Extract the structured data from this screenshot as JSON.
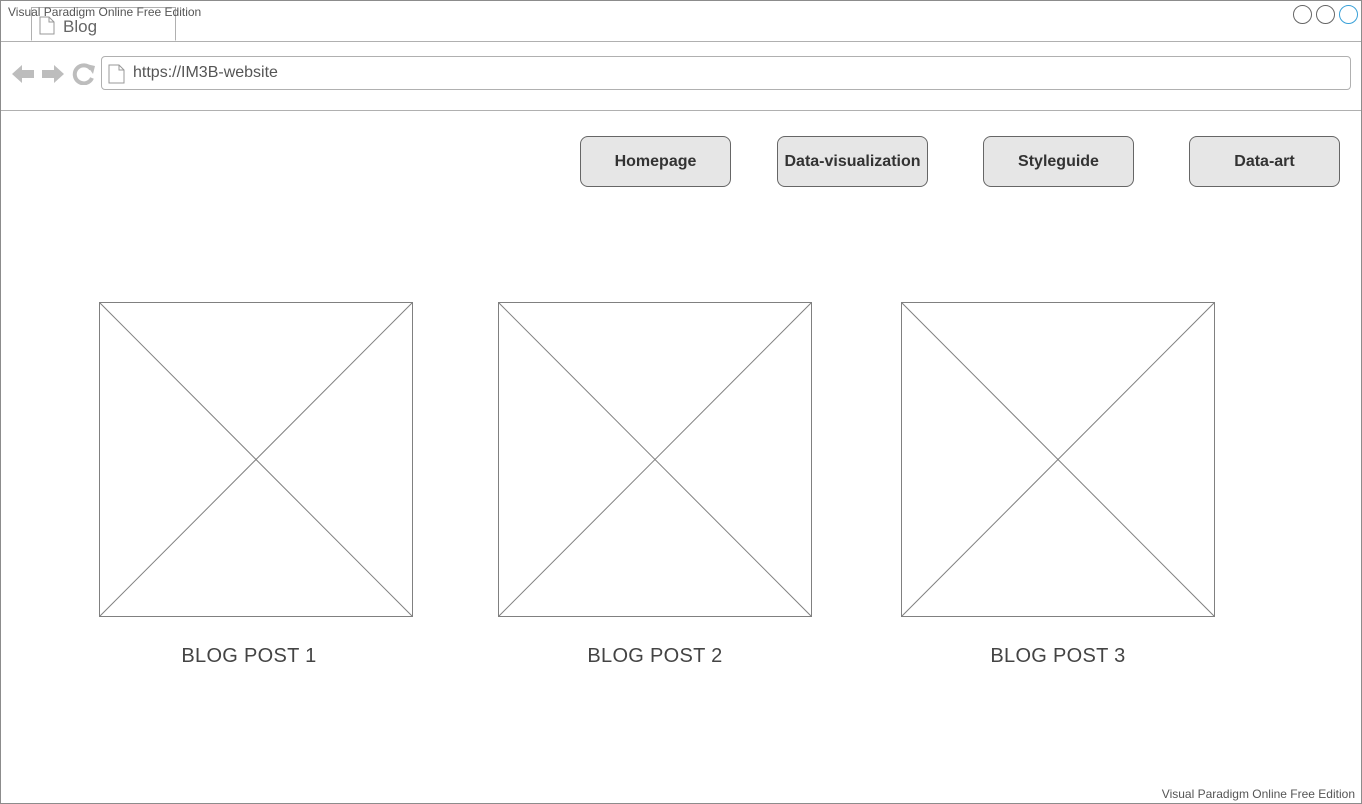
{
  "watermark": "Visual Paradigm Online Free Edition",
  "browser": {
    "tab_label": "Blog",
    "url": "https://IM3B-website"
  },
  "nav": [
    {
      "label": "Homepage"
    },
    {
      "label": "Data-visualization"
    },
    {
      "label": "Styleguide"
    },
    {
      "label": "Data-art"
    }
  ],
  "posts": [
    {
      "title": "BLOG POST 1"
    },
    {
      "title": "BLOG POST 2"
    },
    {
      "title": "BLOG POST 3"
    }
  ],
  "icons": [
    "page-icon",
    "back-arrow-icon",
    "forward-arrow-icon",
    "refresh-icon",
    "window-control-icon",
    "image-placeholder-icon"
  ],
  "colors": {
    "button_bg": "#e6e6e6",
    "active_control": "#3aa1d8"
  }
}
